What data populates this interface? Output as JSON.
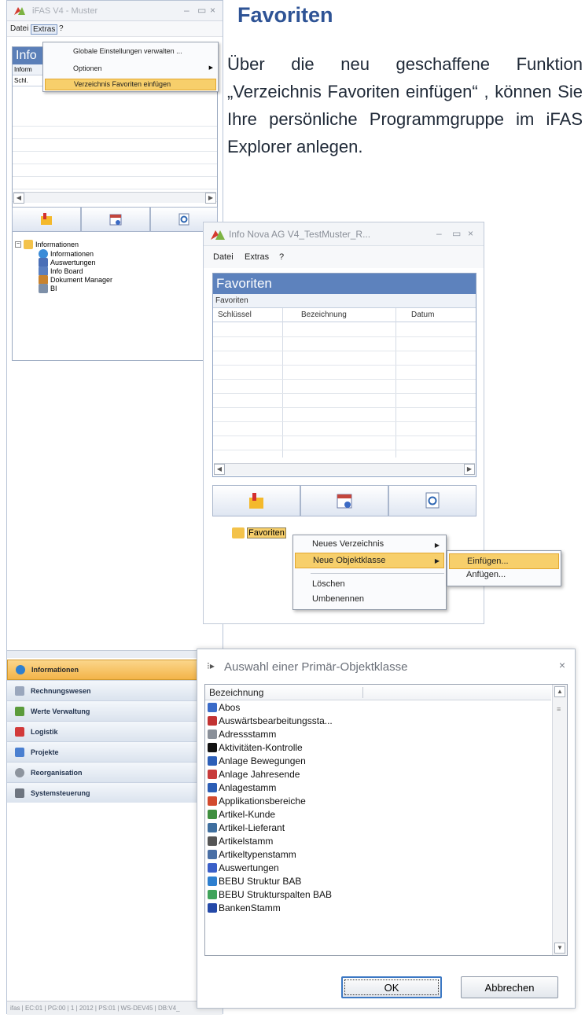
{
  "left_window": {
    "title": "iFAS V4 - Muster",
    "controls": [
      "–",
      "▭",
      "×"
    ],
    "menu": [
      "Datei",
      "Extras",
      "?"
    ],
    "panel_title": "Info",
    "sub_label": "Inform",
    "col_label": "Schl.",
    "dropdown": [
      "Globale Einstellungen verwalten ...",
      "Optionen",
      "Verzeichnis Favoriten einfügen"
    ],
    "tree": [
      "Informationen",
      "Informationen",
      "Auswertungen",
      "Info Board",
      "Dokument Manager",
      "BI"
    ],
    "nav": [
      "Informationen",
      "Rechnungswesen",
      "Werte Verwaltung",
      "Logistik",
      "Projekte",
      "Reorganisation",
      "Systemsteuerung"
    ],
    "status": "ifas | EC:01 | PG:00 | 1 | 2012 | PS:01 | WS-DEV45 | DB:V4_"
  },
  "heading": "Favoriten",
  "paragraph": "Über die neu geschaffene Funktion „Verzeichnis Favoriten einfügen“ , können Sie Ihre persönliche Programmgruppe im iFAS Explorer anlegen.",
  "window2": {
    "title": "Info Nova AG V4_TestMuster_R...",
    "controls": [
      "–",
      "▭",
      "×"
    ],
    "menu": [
      "Datei",
      "Extras",
      "?"
    ],
    "panel_title": "Favoriten",
    "sub_label": "Favoriten",
    "columns": [
      "Schlüssel",
      "Bezeichnung",
      "Datum"
    ],
    "tree_node": "Favoriten",
    "context_menu": [
      "Neues Verzeichnis",
      "Neue Objektklasse",
      "Löschen",
      "Umbenennen"
    ],
    "submenu": [
      "Einfügen...",
      "Anfügen..."
    ]
  },
  "dialog": {
    "title": "Auswahl einer Primär-Objektklasse",
    "close": "×",
    "column": "Bezeichnung",
    "items": [
      "Abos",
      "Auswärtsbearbeitungssta...",
      "Adressstamm",
      "Aktivitäten-Kontrolle",
      "Anlage Bewegungen",
      "Anlage Jahresende",
      "Anlagestamm",
      "Applikationsbereiche",
      "Artikel-Kunde",
      "Artikel-Lieferant",
      "Artikelstamm",
      "Artikeltypenstamm",
      "Auswertungen",
      "BEBU Struktur BAB",
      "BEBU Strukturspalten BAB",
      "BankenStamm"
    ],
    "ok": "OK",
    "cancel": "Abbrechen"
  },
  "colors": {
    "accent": "#2e5395",
    "panel_header": "#5b7fb8",
    "highlight": "#f7cf6b"
  }
}
